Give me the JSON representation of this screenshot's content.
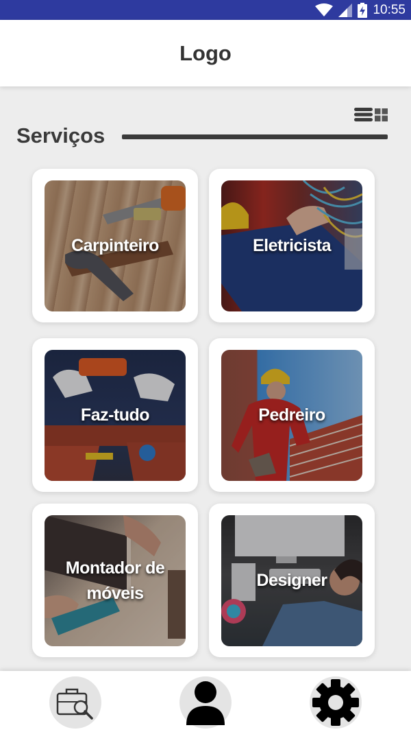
{
  "status_bar": {
    "time": "10:55",
    "icons": [
      "wifi-icon",
      "signal-icon",
      "battery-charging-icon"
    ],
    "background": "#2e3a9f"
  },
  "app_bar": {
    "title": "Logo"
  },
  "services_section": {
    "title": "Serviços",
    "view_toggle": [
      "list-view-icon",
      "grid-view-icon"
    ],
    "cards": [
      {
        "label": "Carpinteiro",
        "image": "carpenter-tools-photo"
      },
      {
        "label": "Eletricista",
        "image": "electrician-wiring-photo"
      },
      {
        "label": "Faz-tudo",
        "image": "handyman-tool-belt-photo"
      },
      {
        "label": "Pedreiro",
        "image": "mason-bricklaying-photo"
      },
      {
        "label": "Montador de móveis",
        "image": "furniture-assembly-photo"
      },
      {
        "label": "Designer",
        "image": "designer-computer-photo"
      }
    ]
  },
  "bottom_nav": {
    "items": [
      "briefcase-search-icon",
      "user-profile-icon",
      "settings-gear-icon"
    ]
  }
}
